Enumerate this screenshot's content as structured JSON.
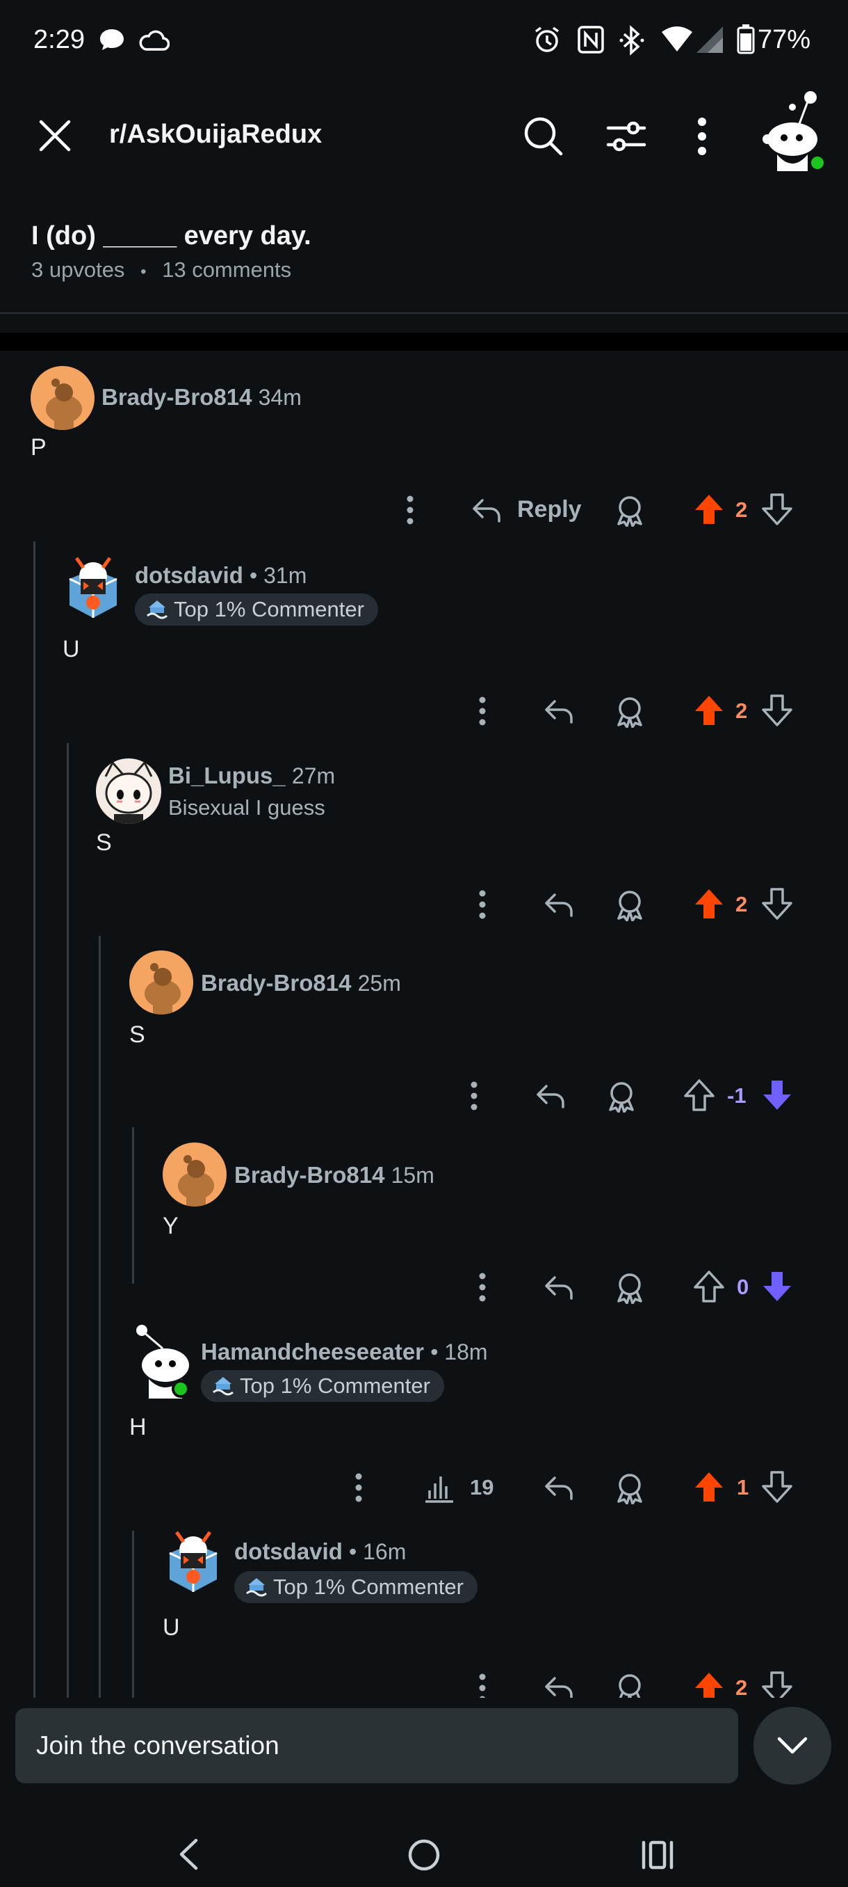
{
  "status_bar": {
    "time": "2:29",
    "battery": "77%"
  },
  "header": {
    "subreddit": "r/AskOuijaRedux"
  },
  "post": {
    "title": "I (do) _____ every day.",
    "upvotes": "3 upvotes",
    "dot": "•",
    "comments": "13 comments"
  },
  "comments": [
    {
      "user": "Brady-Bro814",
      "time": "34m",
      "body": "P",
      "votes": "2",
      "vote_state": "up",
      "reply_label": "Reply"
    },
    {
      "user": "dotsdavid",
      "time": "• 31m",
      "flair": "Top 1% Commenter",
      "body": "U",
      "votes": "2",
      "vote_state": "up"
    },
    {
      "user": "Bi_Lupus_",
      "time": "27m",
      "subline": "Bisexual I guess",
      "body": "S",
      "votes": "2",
      "vote_state": "up"
    },
    {
      "user": "Brady-Bro814",
      "time": "25m",
      "body": "S",
      "votes": "-1",
      "vote_state": "down"
    },
    {
      "user": "Brady-Bro814",
      "time": "15m",
      "body": "Y",
      "votes": "0",
      "vote_state": "down"
    },
    {
      "user": "Hamandcheeseeater",
      "time": "• 18m",
      "flair": "Top 1% Commenter",
      "body": "H",
      "votes": "1",
      "vote_state": "up",
      "views": "19"
    },
    {
      "user": "dotsdavid",
      "time": "• 16m",
      "flair": "Top 1% Commenter",
      "body": "U",
      "votes": "2",
      "vote_state": "up"
    }
  ],
  "composer": {
    "placeholder": "Join the conversation"
  },
  "colors": {
    "background": "#0e1113",
    "upvote": "#ff4500",
    "downvote": "#7060ff",
    "vote_count_up": "#ff8b60",
    "vote_count_down": "#a99bff",
    "meta": "#a8b3b9"
  }
}
